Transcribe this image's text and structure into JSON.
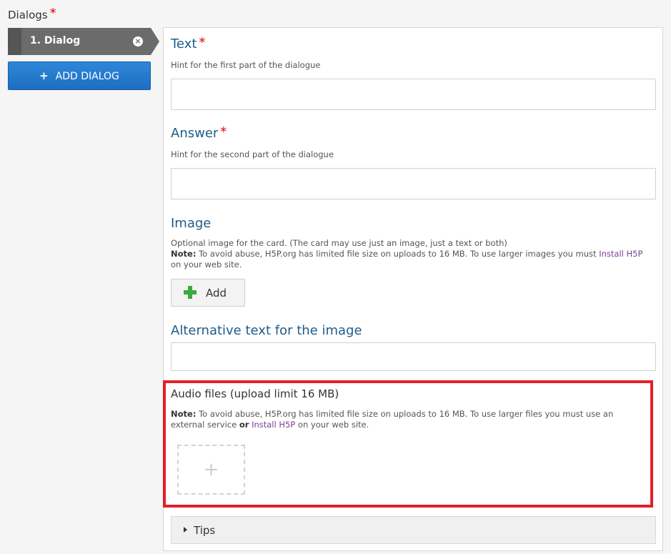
{
  "dialogs": {
    "title": "Dialogs",
    "required_mark": "*",
    "items": [
      {
        "label": "1. Dialog",
        "close_icon": "⊗"
      }
    ],
    "add_label": "ADD DIALOG",
    "add_icon": "+"
  },
  "fields": {
    "text": {
      "label": "Text",
      "required": "*",
      "hint": "Hint for the first part of the dialogue",
      "value": ""
    },
    "answer": {
      "label": "Answer",
      "required": "*",
      "hint": "Hint for the second part of the dialogue",
      "value": ""
    },
    "image": {
      "label": "Image",
      "hint": "Optional image for the card. (The card may use just an image, just a text or both)",
      "note_prefix": "Note:",
      "note_text": " To avoid abuse, H5P.org has limited file size on uploads to 16 MB. To use larger images you must ",
      "note_link": "Install H5P",
      "note_suffix": " on your web site.",
      "add_label": "Add"
    },
    "alt_text": {
      "label": "Alternative text for the image",
      "value": ""
    },
    "audio": {
      "label": "Audio files (upload limit 16 MB)",
      "note_prefix": "Note:",
      "note_text": " To avoid abuse, H5P.org has limited file size on uploads to 16 MB. To use larger files you must use an external service ",
      "note_or": "or",
      "note_link": "Install H5P",
      "note_suffix": " on your web site.",
      "add_icon": "+"
    },
    "tips": {
      "label": "Tips"
    }
  },
  "colors": {
    "highlight": "#e0202a",
    "label_blue": "#1f5c8a",
    "button_blue": "#1d6fc2"
  }
}
